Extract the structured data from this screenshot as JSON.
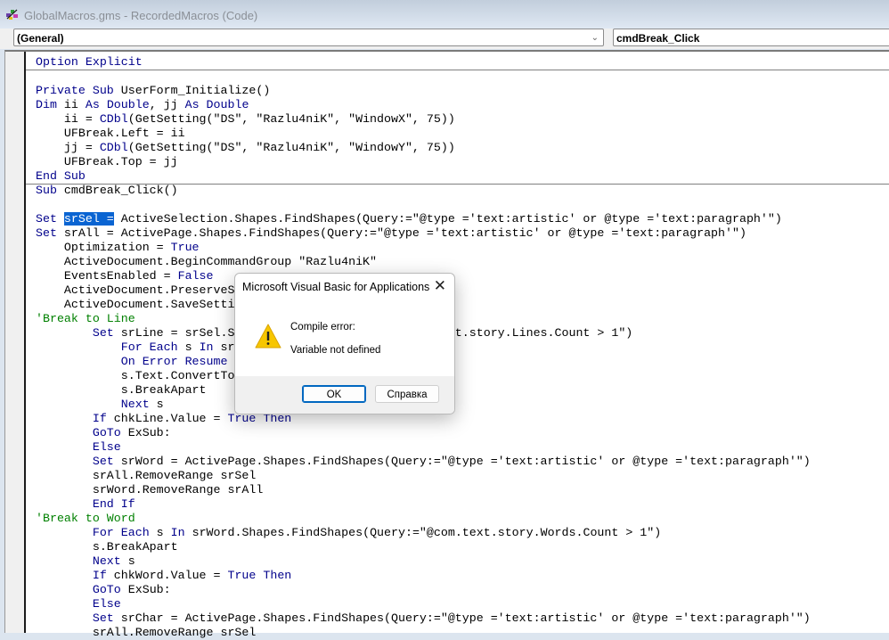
{
  "window": {
    "title": "GlobalMacros.gms - RecordedMacros (Code)"
  },
  "object_combo": {
    "value": "(General)"
  },
  "procedure_combo": {
    "value": "cmdBreak_Click"
  },
  "code_lines": [
    [
      [
        "Option Explicit",
        "k"
      ]
    ],
    [],
    [
      [
        "Private Sub ",
        "k"
      ],
      [
        "UserForm_Initialize()",
        "n"
      ]
    ],
    [
      [
        "Dim ",
        "k"
      ],
      [
        "ii ",
        "n"
      ],
      [
        "As Double",
        "k"
      ],
      [
        ", jj ",
        "n"
      ],
      [
        "As Double",
        "k"
      ]
    ],
    [
      [
        "    ii = ",
        "n"
      ],
      [
        "CDbl",
        "k"
      ],
      [
        "(GetSetting(\"DS\", \"Razlu4niK\", \"WindowX\", 75))",
        "n"
      ]
    ],
    [
      [
        "    UFBreak.Left = ii",
        "n"
      ]
    ],
    [
      [
        "    jj = ",
        "n"
      ],
      [
        "CDbl",
        "k"
      ],
      [
        "(GetSetting(\"DS\", \"Razlu4niK\", \"WindowY\", 75))",
        "n"
      ]
    ],
    [
      [
        "    UFBreak.Top = jj",
        "n"
      ]
    ],
    [
      [
        "End Sub",
        "k"
      ]
    ],
    [
      [
        "Sub ",
        "k"
      ],
      [
        "cmdBreak_Click()",
        "n"
      ]
    ],
    [],
    [
      [
        "Set ",
        "k"
      ],
      [
        "srSel =",
        "sel"
      ],
      [
        " ActiveSelection.Shapes.FindShapes(Query:=\"@type ='text:artistic' or @type ='text:paragraph'\")",
        "n"
      ]
    ],
    [
      [
        "Set ",
        "k"
      ],
      [
        "srAll = ActivePage.Shapes.FindShapes(Query:=\"@type ='text:artistic' or @type ='text:paragraph'\")",
        "n"
      ]
    ],
    [
      [
        "    Optimization = ",
        "n"
      ],
      [
        "True",
        "k"
      ]
    ],
    [
      [
        "    ActiveDocument.BeginCommandGroup \"Razlu4niK\"",
        "n"
      ]
    ],
    [
      [
        "    EventsEnabled = ",
        "n"
      ],
      [
        "False",
        "k"
      ]
    ],
    [
      [
        "    ActiveDocument.PreserveS",
        "n"
      ]
    ],
    [
      [
        "    ActiveDocument.SaveSetti",
        "n"
      ]
    ],
    [
      [
        "'Break to Line",
        "c"
      ]
    ],
    [
      [
        "        ",
        "n"
      ],
      [
        "Set ",
        "k"
      ],
      [
        "srLine = srSel.S",
        "n"
      ],
      [
        "                             ",
        "n"
      ],
      [
        "ext.story.Lines.Count > 1\")",
        "n"
      ]
    ],
    [
      [
        "            ",
        "n"
      ],
      [
        "For Each ",
        "k"
      ],
      [
        "s ",
        "n"
      ],
      [
        "In ",
        "k"
      ],
      [
        "sr",
        "n"
      ]
    ],
    [
      [
        "            ",
        "n"
      ],
      [
        "On Error Resume",
        "k"
      ]
    ],
    [
      [
        "            s.Text.ConvertTo",
        "n"
      ]
    ],
    [
      [
        "            s.BreakApart",
        "n"
      ]
    ],
    [
      [
        "            ",
        "n"
      ],
      [
        "Next ",
        "k"
      ],
      [
        "s",
        "n"
      ]
    ],
    [
      [
        "        ",
        "n"
      ],
      [
        "If ",
        "k"
      ],
      [
        "chkLine.Value = ",
        "n"
      ],
      [
        "True Then",
        "k"
      ]
    ],
    [
      [
        "        ",
        "n"
      ],
      [
        "GoTo ",
        "k"
      ],
      [
        "ExSub:",
        "n"
      ]
    ],
    [
      [
        "        ",
        "n"
      ],
      [
        "Else",
        "k"
      ]
    ],
    [
      [
        "        ",
        "n"
      ],
      [
        "Set ",
        "k"
      ],
      [
        "srWord = ActivePage.Shapes.FindShapes(Query:=\"@type ='text:artistic' or @type ='text:paragraph'\")",
        "n"
      ]
    ],
    [
      [
        "        srAll.RemoveRange srSel",
        "n"
      ]
    ],
    [
      [
        "        srWord.RemoveRange srAll",
        "n"
      ]
    ],
    [
      [
        "        ",
        "n"
      ],
      [
        "End If",
        "k"
      ]
    ],
    [
      [
        "'Break to Word",
        "c"
      ]
    ],
    [
      [
        "        ",
        "n"
      ],
      [
        "For Each ",
        "k"
      ],
      [
        "s ",
        "n"
      ],
      [
        "In ",
        "k"
      ],
      [
        "srWord.Shapes.FindShapes(Query:=\"@com.text.story.Words.Count > 1\")",
        "n"
      ]
    ],
    [
      [
        "        s.BreakApart",
        "n"
      ]
    ],
    [
      [
        "        ",
        "n"
      ],
      [
        "Next ",
        "k"
      ],
      [
        "s",
        "n"
      ]
    ],
    [
      [
        "        ",
        "n"
      ],
      [
        "If ",
        "k"
      ],
      [
        "chkWord.Value = ",
        "n"
      ],
      [
        "True Then",
        "k"
      ]
    ],
    [
      [
        "        ",
        "n"
      ],
      [
        "GoTo ",
        "k"
      ],
      [
        "ExSub:",
        "n"
      ]
    ],
    [
      [
        "        ",
        "n"
      ],
      [
        "Else",
        "k"
      ]
    ],
    [
      [
        "        ",
        "n"
      ],
      [
        "Set ",
        "k"
      ],
      [
        "srChar = ActivePage.Shapes.FindShapes(Query:=\"@type ='text:artistic' or @type ='text:paragraph'\")",
        "n"
      ]
    ],
    [
      [
        "        srAll.RemoveRange srSel",
        "n"
      ]
    ]
  ],
  "dialog": {
    "title": "Microsoft Visual Basic for Applications",
    "heading": "Compile error:",
    "message": "Variable not defined",
    "ok_label": "OK",
    "help_label": "Справка",
    "icon": "warning-icon"
  },
  "colors": {
    "keyword": "#00008b",
    "comment": "#008000",
    "selection": "#0a64d2"
  }
}
